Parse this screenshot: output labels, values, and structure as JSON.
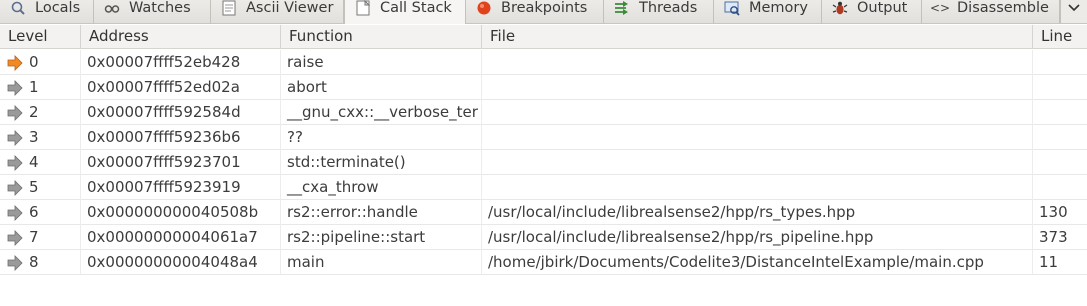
{
  "tabs": [
    {
      "label": "Locals",
      "icon": "locals-icon"
    },
    {
      "label": "Watches",
      "icon": "watches-icon"
    },
    {
      "label": "Ascii Viewer",
      "icon": "ascii-viewer-icon"
    },
    {
      "label": "Call Stack",
      "icon": "call-stack-icon",
      "active": true
    },
    {
      "label": "Breakpoints",
      "icon": "breakpoint-icon"
    },
    {
      "label": "Threads",
      "icon": "threads-icon"
    },
    {
      "label": "Memory",
      "icon": "memory-icon"
    },
    {
      "label": "Output",
      "icon": "output-icon"
    },
    {
      "label": "Disassemble",
      "icon": "disassemble-icon"
    }
  ],
  "columns": [
    "Level",
    "Address",
    "Function",
    "File",
    "Line"
  ],
  "rows": [
    {
      "level": "0",
      "address": "0x00007ffff52eb428",
      "function": "raise",
      "file": "",
      "line": "",
      "current": true
    },
    {
      "level": "1",
      "address": "0x00007ffff52ed02a",
      "function": "abort",
      "file": "",
      "line": ""
    },
    {
      "level": "2",
      "address": "0x00007ffff592584d",
      "function": "__gnu_cxx::__verbose_ter",
      "file": "",
      "line": ""
    },
    {
      "level": "3",
      "address": "0x00007ffff59236b6",
      "function": "??",
      "file": "",
      "line": ""
    },
    {
      "level": "4",
      "address": "0x00007ffff5923701",
      "function": "std::terminate()",
      "file": "",
      "line": ""
    },
    {
      "level": "5",
      "address": "0x00007ffff5923919",
      "function": "__cxa_throw",
      "file": "",
      "line": ""
    },
    {
      "level": "6",
      "address": "0x000000000040508b",
      "function": "rs2::error::handle",
      "file": "/usr/local/include/librealsense2/hpp/rs_types.hpp",
      "line": "130"
    },
    {
      "level": "7",
      "address": "0x00000000004061a7",
      "function": "rs2::pipeline::start",
      "file": "/usr/local/include/librealsense2/hpp/rs_pipeline.hpp",
      "line": "373"
    },
    {
      "level": "8",
      "address": "0x00000000004048a4",
      "function": "main",
      "file": "/home/jbirk/Documents/Codelite3/DistanceIntelExample/main.cpp",
      "line": "11"
    }
  ],
  "colors": {
    "current_frame_arrow": "#f08a24",
    "frame_arrow": "#8a8a8a",
    "breakpoint": "#e0421b"
  }
}
